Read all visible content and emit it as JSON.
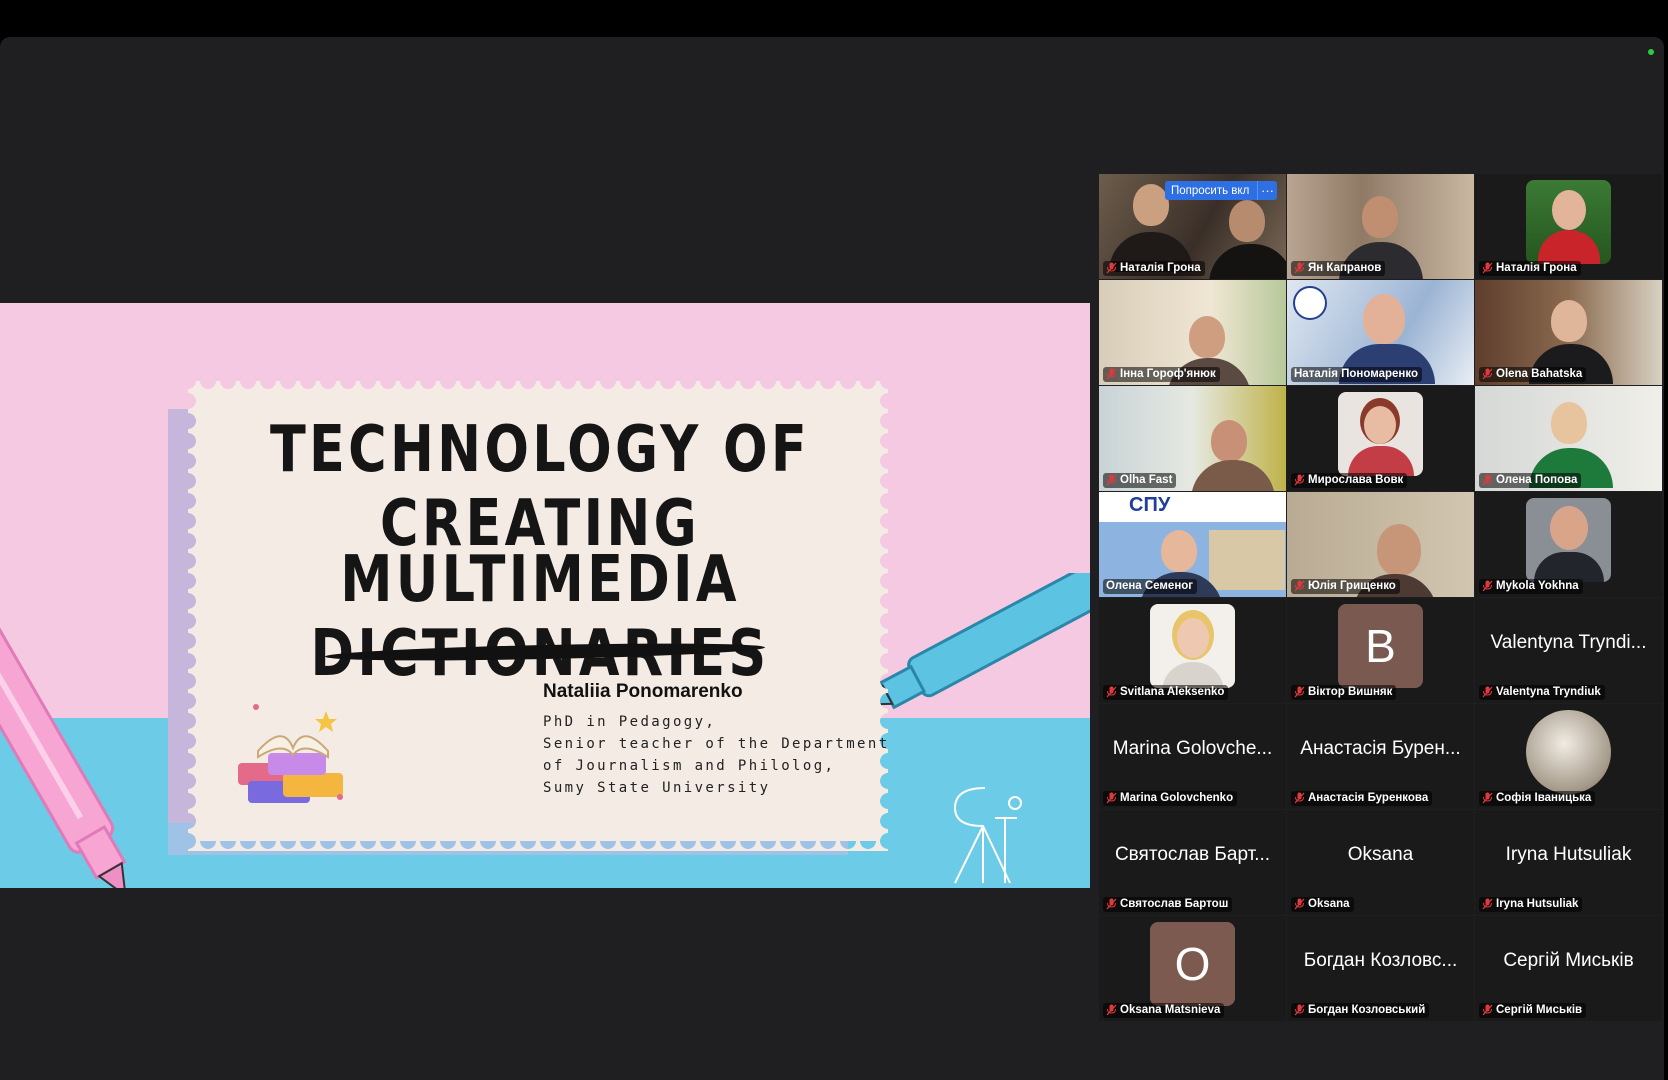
{
  "slide": {
    "title_line1": "TECHNOLOGY OF CREATING",
    "title_line2": "MULTIMEDIA DICTIONARIES",
    "presenter_name": "Nataliia Ponomarenko",
    "presenter_lines": [
      "PhD in Pedagogy,",
      "Senior teacher of the Department",
      "of Journalism and Philolog,",
      "Sumy State University"
    ]
  },
  "gallery": {
    "request_button_label": "Попросить вкл",
    "more_button_label": "···",
    "tiles": [
      {
        "name": "Наталія Грона",
        "kind": "video"
      },
      {
        "name": "Ян Капранов",
        "kind": "video"
      },
      {
        "name": "Наталія Грона",
        "kind": "video"
      },
      {
        "name": "Інна Гороф'янюк",
        "kind": "video"
      },
      {
        "name": "Наталія Пономаренко",
        "kind": "video",
        "active": true
      },
      {
        "name": "Olena Bahatska",
        "kind": "video"
      },
      {
        "name": "Olha Fast",
        "kind": "video"
      },
      {
        "name": "Мирослава Вовк",
        "kind": "photo"
      },
      {
        "name": "Олена Попова",
        "kind": "video"
      },
      {
        "name": "Олена Семеног",
        "kind": "video",
        "banner": "СПУ"
      },
      {
        "name": "Юлія Грищенко",
        "kind": "video"
      },
      {
        "name": "Mykola Yokhna",
        "kind": "photo"
      },
      {
        "name": "Svitlana Aleksenko",
        "kind": "photo"
      },
      {
        "name": "Віктор Вишняк",
        "kind": "initial",
        "initial": "B"
      },
      {
        "name": "Valentyna Tryndiuk",
        "kind": "text",
        "display": "Valentyna Tryndi..."
      },
      {
        "name": "Marina Golovchenko",
        "kind": "text",
        "display": "Marina Golovche..."
      },
      {
        "name": "Анастасія Буренкова",
        "kind": "text",
        "display": "Анастасія Бурен..."
      },
      {
        "name": "Софія Іваницька",
        "kind": "photo"
      },
      {
        "name": "Святослав Бартош",
        "kind": "text",
        "display": "Святослав Барт..."
      },
      {
        "name": "Oksana",
        "kind": "text",
        "display": "Oksana"
      },
      {
        "name": "Iryna Hutsuliak",
        "kind": "text",
        "display": "Iryna Hutsuliak"
      },
      {
        "name": "Oksana Matsnieva",
        "kind": "initial",
        "initial": "O"
      },
      {
        "name": "Богдан Козловський",
        "kind": "text",
        "display": "Богдан Козловс..."
      },
      {
        "name": "Сергій Миськів",
        "kind": "text",
        "display": "Сергій Миськів"
      }
    ]
  },
  "colors": {
    "slide_pink": "#f5c9e2",
    "slide_blue": "#6ccbe6",
    "card": "#f4ebe4",
    "active_speaker": "#3ec34a",
    "request_button": "#2f6fe4",
    "muted_mic": "#e0393e"
  }
}
